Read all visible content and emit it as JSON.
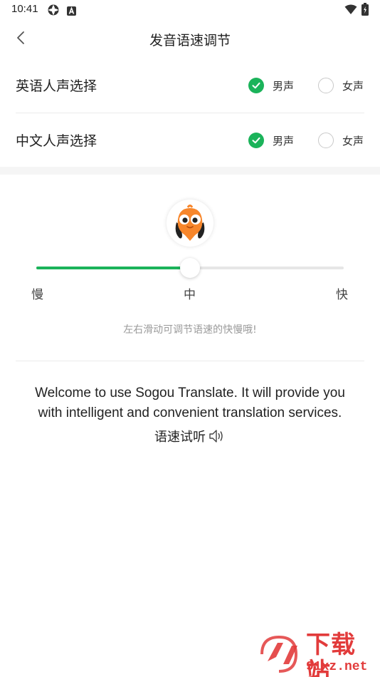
{
  "status_bar": {
    "time": "10:41"
  },
  "header": {
    "title": "发音语速调节"
  },
  "voice_settings": [
    {
      "label": "英语人声选择",
      "options": [
        {
          "label": "男声",
          "checked": true
        },
        {
          "label": "女声",
          "checked": false
        }
      ]
    },
    {
      "label": "中文人声选择",
      "options": [
        {
          "label": "男声",
          "checked": true
        },
        {
          "label": "女声",
          "checked": false
        }
      ]
    }
  ],
  "speed": {
    "value": 0.5,
    "min_label": "慢",
    "mid_label": "中",
    "max_label": "快",
    "hint": "左右滑动可调节语速的快慢哦!"
  },
  "sample": {
    "text": "Welcome to use Sogou Translate. It will provide you with intelligent and convenient translation services.",
    "listen_label": "语速试听"
  },
  "watermark": {
    "title": "下载站",
    "url": "91xz.net"
  },
  "colors": {
    "accent": "#1bb35a",
    "watermark": "#e23b3b"
  }
}
